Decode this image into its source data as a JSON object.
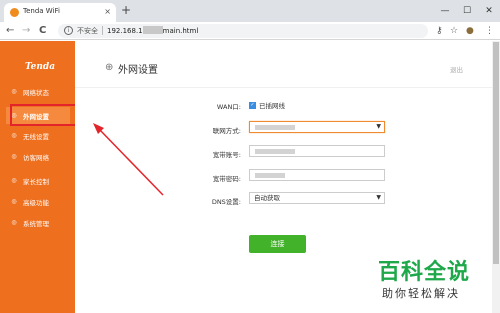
{
  "browser": {
    "tab_title": "Tenda WiFi",
    "tab_close": "×",
    "new_tab": "+",
    "window_controls": [
      "—",
      "☐",
      "✕"
    ],
    "nav": {
      "back": "←",
      "forward": "→",
      "reload": "C"
    },
    "insecure_label": "不安全",
    "url_prefix": "192.168.1",
    "url_suffix": "main.html",
    "toolbar_icons": {
      "key": "⚷",
      "star": "☆",
      "profile": "●",
      "menu": "⋮"
    }
  },
  "sidebar": {
    "logo": "Tenda",
    "items": [
      {
        "label": "网络状态",
        "icon": "◎"
      },
      {
        "label": "外网设置",
        "icon": "◎",
        "active": true
      },
      {
        "label": "无线设置",
        "icon": "◎"
      },
      {
        "label": "访客网络",
        "icon": "◎"
      },
      {
        "label": "家长控制",
        "icon": "◎"
      },
      {
        "label": "高级功能",
        "icon": "◎"
      },
      {
        "label": "系统管理",
        "icon": "◎"
      }
    ]
  },
  "main": {
    "title": "外网设置",
    "logout": "退出",
    "wan_label": "WAN口:",
    "wan_status": "已插网线",
    "connection_type_label": "联网方式:",
    "account_label": "宽带账号:",
    "password_label": "宽带密码:",
    "dns_label": "DNS设置:",
    "dns_value": "自动获取",
    "connect_button": "连接"
  },
  "watermark": {
    "main": "百科全说",
    "sub": "助你轻松解决"
  },
  "colors": {
    "brand_orange": "#ee6f1e",
    "connect_green": "#43b22b",
    "annotation_red": "#e3252b"
  }
}
